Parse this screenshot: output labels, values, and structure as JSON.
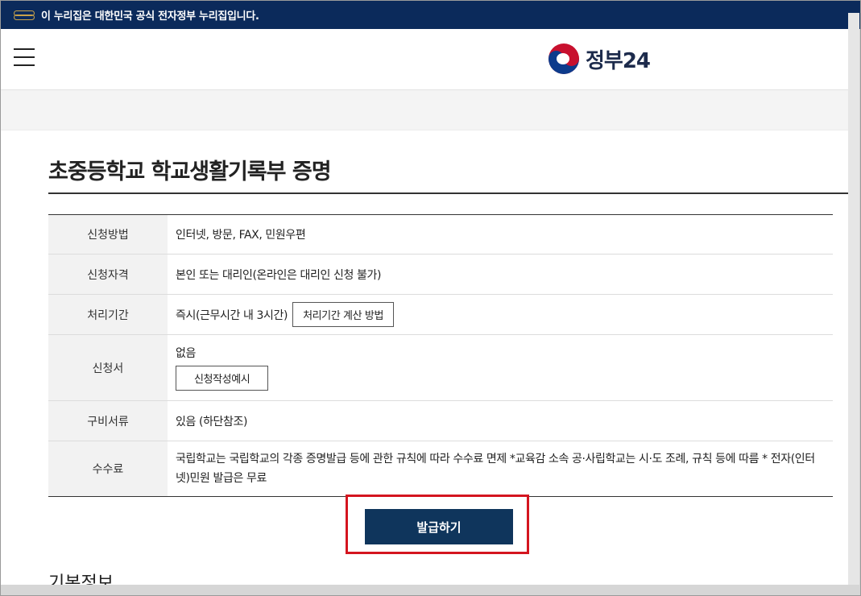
{
  "banner": {
    "text": "이 누리집은 대한민국 공식 전자정부 누리집입니다."
  },
  "header": {
    "logo_text": "정부24",
    "menu_icon": "hamburger-menu-icon"
  },
  "service": {
    "title": "초중등학교 학교생활기록부 증명"
  },
  "info_rows": [
    {
      "label": "신청방법",
      "value": "인터넷, 방문, FAX, 민원우편"
    },
    {
      "label": "신청자격",
      "value": "본인 또는 대리인(온라인은 대리인 신청 불가)"
    },
    {
      "label": "처리기간",
      "value": "즉시(근무시간 내 3시간)",
      "button": "처리기간 계산 방법"
    },
    {
      "label": "신청서",
      "value": "없음",
      "button": "신청작성예시"
    },
    {
      "label": "구비서류",
      "value": "있음 (하단참조)"
    },
    {
      "label": "수수료",
      "value": "국립학교는 국립학교의 각종 증명발급 등에 관한 규칙에 따라 수수료 면제 *교육감 소속 공·사립학교는 시·도 조례, 규칙 등에 따름 * 전자(인터넷)민원 발급은 무료"
    }
  ],
  "actions": {
    "issue_label": "발급하기"
  },
  "section": {
    "basic_info": "기본정보"
  },
  "colors": {
    "banner_bg": "#0b2a5b",
    "primary_button": "#0f355c",
    "highlight_border": "#d4151f"
  }
}
